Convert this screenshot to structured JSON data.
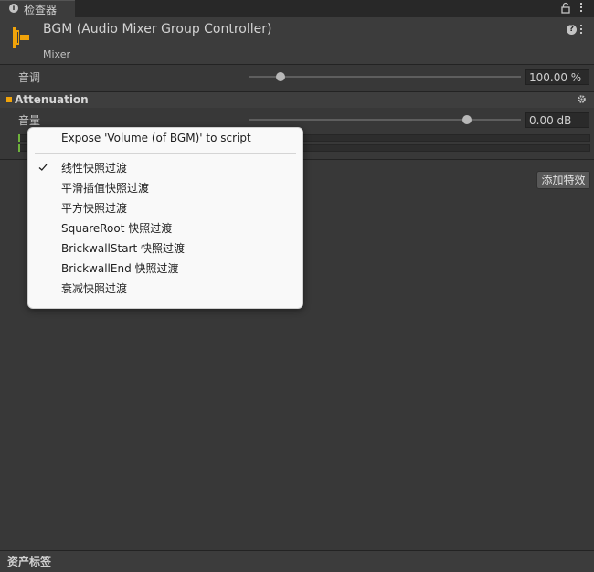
{
  "tab": {
    "label": "检查器",
    "info_glyph": "i"
  },
  "component": {
    "title": "BGM (Audio Mixer Group Controller)",
    "subtitle": "Mixer",
    "help_glyph": "?"
  },
  "pitch": {
    "label": "音调",
    "value": "100.00 %",
    "slider_fraction": 0.115
  },
  "attenuation": {
    "title": "Attenuation",
    "volume_label": "音量",
    "volume_value": "0.00 dB",
    "slider_fraction": 0.8
  },
  "add_effect_label": "添加特效",
  "footer": {
    "label": "资产标签"
  },
  "context_menu": {
    "expose_label": "Expose 'Volume (of BGM)' to script",
    "items": [
      {
        "label": "线性快照过渡",
        "checked": true
      },
      {
        "label": "平滑插值快照过渡",
        "checked": false
      },
      {
        "label": "平方快照过渡",
        "checked": false
      },
      {
        "label": "SquareRoot 快照过渡",
        "checked": false
      },
      {
        "label": "BrickwallStart 快照过渡",
        "checked": false
      },
      {
        "label": "BrickwallEnd 快照过渡",
        "checked": false
      },
      {
        "label": "衰减快照过渡",
        "checked": false
      }
    ]
  },
  "colors": {
    "accent": "#f0a30a",
    "meter_green": "#6fb33c",
    "background": "#383838",
    "menu_background": "#f9f9f9"
  }
}
